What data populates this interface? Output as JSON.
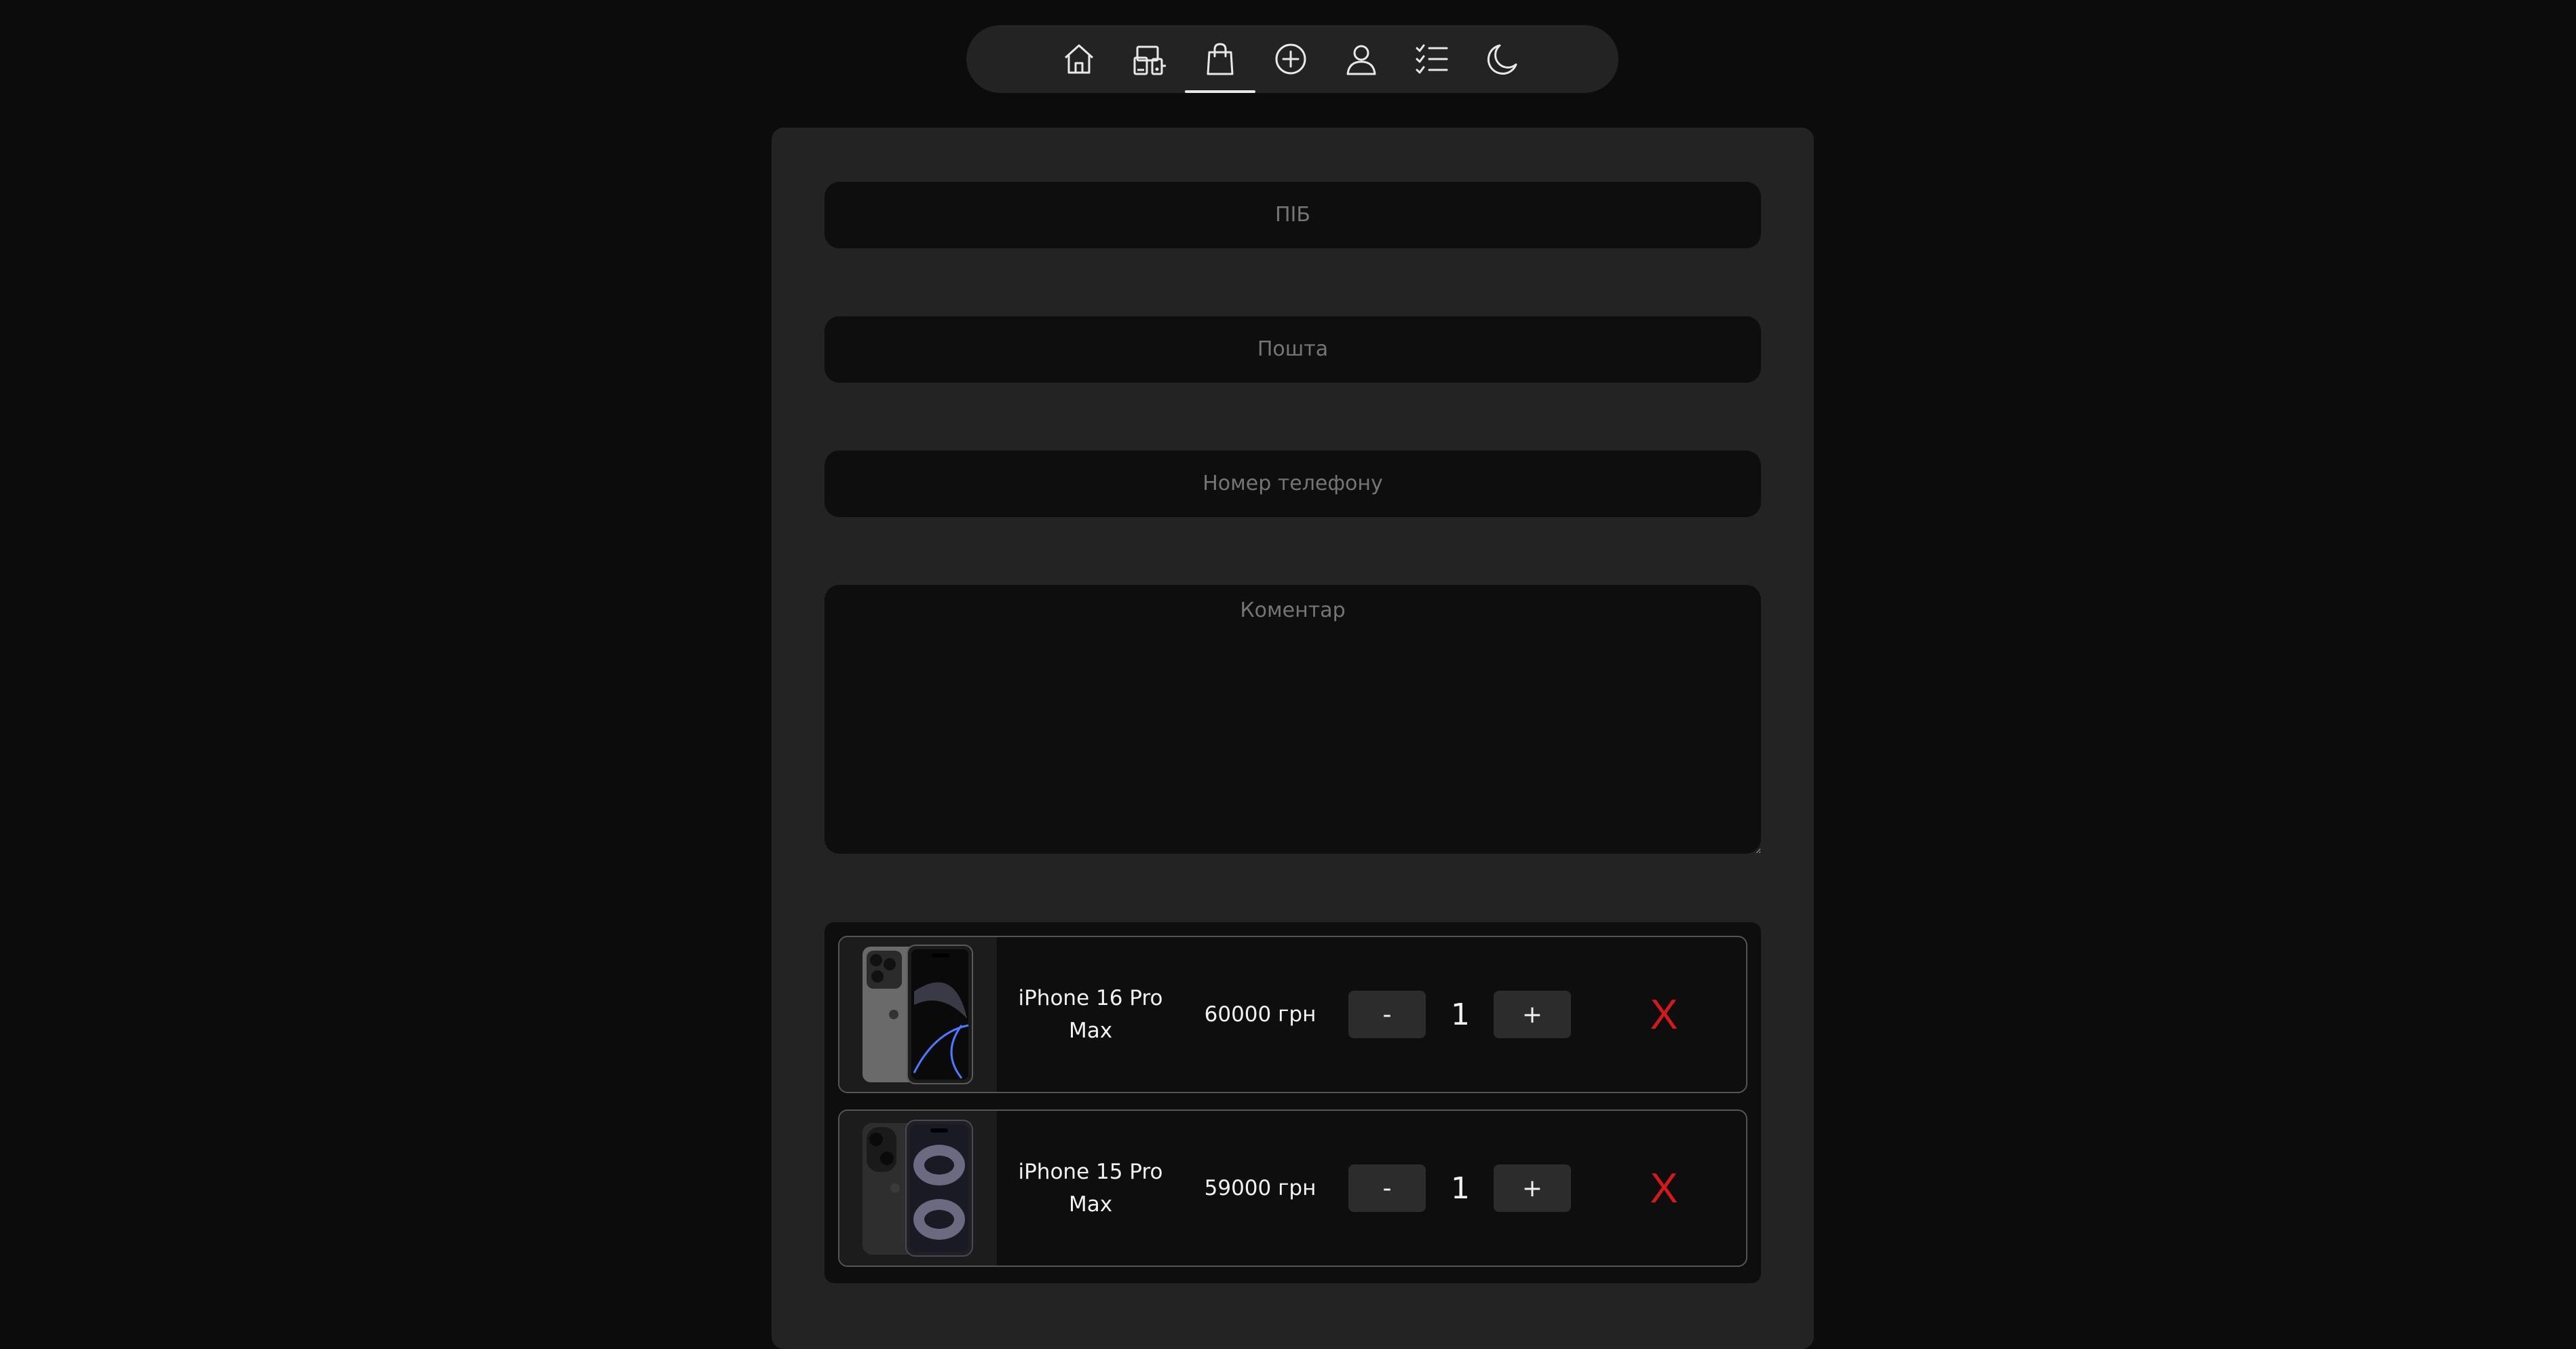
{
  "colors": {
    "page_background": "#0c0c0c",
    "panel_background": "#232323",
    "field_background": "#0e0e0e",
    "remove_accent": "#d11a1a"
  },
  "navbar": {
    "active_item": "cart",
    "items": [
      {
        "icon": "home-icon"
      },
      {
        "icon": "devices-icon"
      },
      {
        "icon": "shopping-bag-icon"
      },
      {
        "icon": "plus-circle-icon"
      },
      {
        "icon": "user-icon"
      },
      {
        "icon": "checklist-icon"
      },
      {
        "icon": "moon-icon"
      }
    ]
  },
  "form": {
    "name_placeholder": "ПІБ",
    "email_placeholder": "Пошта",
    "phone_placeholder": "Номер телефону",
    "comment_placeholder": "Коментар"
  },
  "cart": {
    "items": [
      {
        "name": "iPhone 16 Pro Max",
        "price": "60000 грн",
        "quantity": "1",
        "minus_label": "-",
        "plus_label": "+",
        "remove_label": "X",
        "image": "iphone-16-pro-max-image"
      },
      {
        "name": "iPhone 15 Pro Max",
        "price": "59000 грн",
        "quantity": "1",
        "minus_label": "-",
        "plus_label": "+",
        "remove_label": "X",
        "image": "iphone-15-pro-max-image"
      }
    ]
  }
}
